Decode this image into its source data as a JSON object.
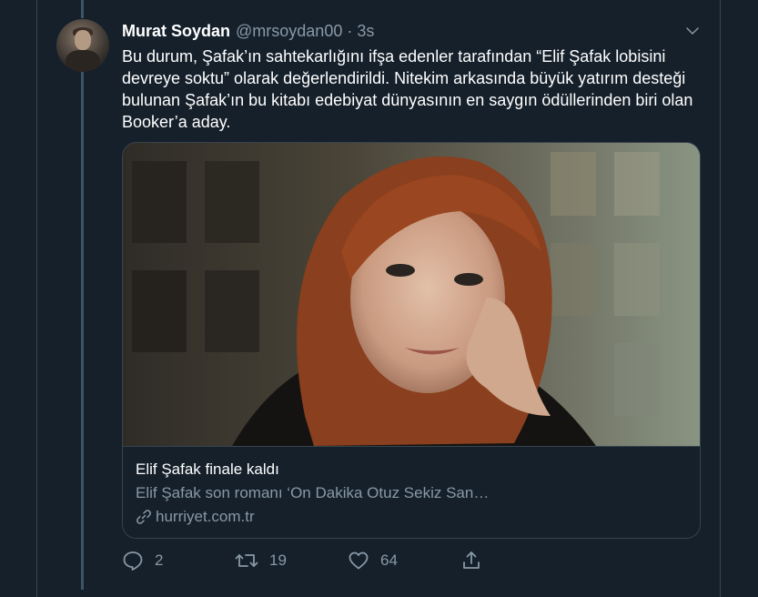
{
  "tweet": {
    "author_name": "Murat Soydan",
    "author_handle": "@mrsoydan00",
    "separator": "·",
    "time": "3s",
    "text": "Bu durum, Şafak’ın sahtekarlığını ifşa edenler tarafından “Elif Şafak lobisini devreye soktu” olarak değerlendirildi. Nitekim arkasında büyük yatırım desteği bulunan Şafak’ın bu kitabı edebiyat dünyasının en saygın ödüllerinden biri olan Booker’a aday."
  },
  "card": {
    "title": "Elif Şafak finale kaldı",
    "description": "Elif Şafak son romanı ‘On Dakika Otuz Sekiz San…",
    "domain": "hurriyet.com.tr"
  },
  "actions": {
    "reply_count": "2",
    "retweet_count": "19",
    "like_count": "64"
  },
  "colors": {
    "background": "#15202b",
    "border": "#38444d",
    "secondary_text": "#8899a6"
  }
}
